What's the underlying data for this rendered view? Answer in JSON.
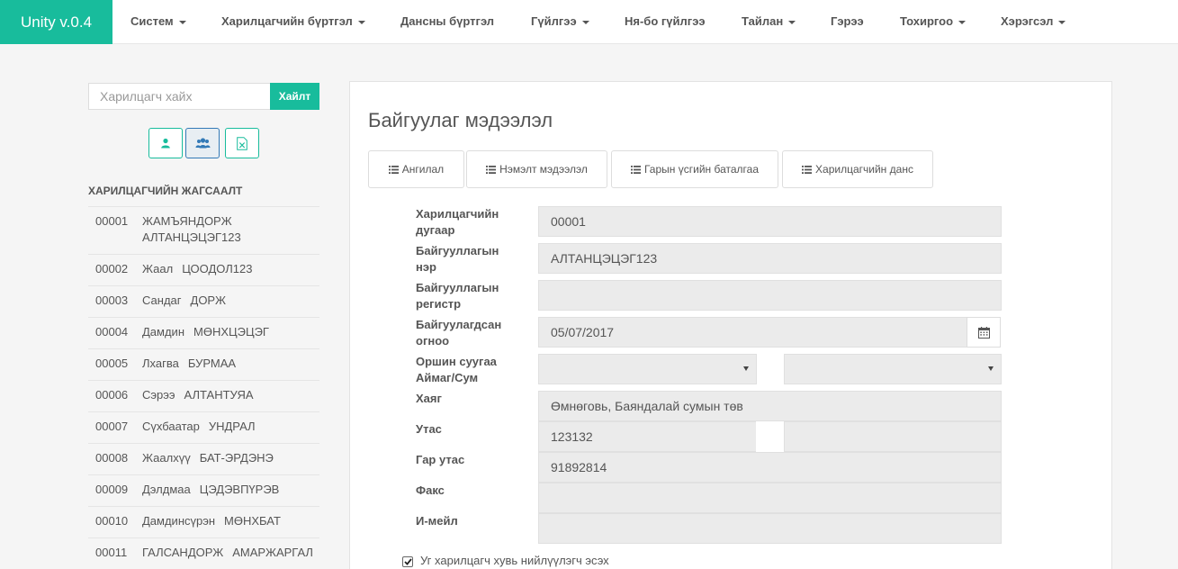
{
  "nav": {
    "brand": "Unity v.0.4",
    "items": [
      {
        "label": "Систем",
        "dropdown": true
      },
      {
        "label": "Харилцагчийн бүртгэл",
        "dropdown": true
      },
      {
        "label": "Дансны бүртгэл",
        "dropdown": false
      },
      {
        "label": "Гүйлгээ",
        "dropdown": true
      },
      {
        "label": "Ня-бо гүйлгээ",
        "dropdown": false
      },
      {
        "label": "Тайлан",
        "dropdown": true
      },
      {
        "label": "Гэрээ",
        "dropdown": false
      },
      {
        "label": "Тохиргоо",
        "dropdown": true
      },
      {
        "label": "Хэрэгсэл",
        "dropdown": true
      }
    ]
  },
  "sidebar": {
    "search_placeholder": "Харилцагч хайх",
    "search_button": "Хайлт",
    "tools": [
      "person-icon",
      "group-icon",
      "excel-icon"
    ],
    "list_title": "ХАРИЛЦАГЧИЙН ЖАГСААЛТ",
    "customers": [
      {
        "num": "00001",
        "first": "ЖАМЪЯНДОРЖ",
        "last": "АЛТАНЦЭЦЭГ123"
      },
      {
        "num": "00002",
        "first": "Жаал",
        "last": "ЦООДОЛ123"
      },
      {
        "num": "00003",
        "first": "Сандаг",
        "last": "ДОРЖ"
      },
      {
        "num": "00004",
        "first": "Дамдин",
        "last": "МӨНХЦЭЦЭГ"
      },
      {
        "num": "00005",
        "first": "Лхагва",
        "last": "БУРМАА"
      },
      {
        "num": "00006",
        "first": "Сэрээ",
        "last": "АЛТАНТУЯА"
      },
      {
        "num": "00007",
        "first": "Сүхбаатар",
        "last": "УНДРАЛ"
      },
      {
        "num": "00008",
        "first": "Жаалхүү",
        "last": "БАТ-ЭРДЭНЭ"
      },
      {
        "num": "00009",
        "first": "Дэлдмаа",
        "last": "ЦЭДЭВПҮРЭВ"
      },
      {
        "num": "00010",
        "first": "Дамдинсүрэн",
        "last": "МӨНХБАТ"
      },
      {
        "num": "00011",
        "first": "ГАЛСАНДОРЖ",
        "last": "АМАРЖАРГАЛ"
      }
    ]
  },
  "main": {
    "title": "Байгуулаг мэдээлэл",
    "tabs": [
      "Ангилал",
      "Нэмэлт мэдээлэл",
      "Гарын үсгийн баталгаа",
      "Харилцагчийн данс"
    ],
    "fields": {
      "customer_number_label": "Харилцагчийн дугаар",
      "customer_number": "00001",
      "org_name_label": "Байгууллагын нэр",
      "org_name": "АЛТАНЦЭЦЭГ123",
      "org_register_label": "Байгууллагын регистр",
      "org_register": "",
      "founded_label": "Байгуулагдсан огноо",
      "founded": "05/07/2017",
      "residence_label": "Оршин суугаа Аймаг/Сум",
      "aimag": "",
      "sum": "",
      "address_label": "Хаяг",
      "address": "Өмнөговь, Баяндалай сумын төв",
      "phone_label": "Утас",
      "phone": "123132",
      "phone2": "",
      "mobile_label": "Гар утас",
      "mobile": "91892814",
      "fax_label": "Факс",
      "fax": "",
      "email_label": "И-мейл",
      "email": ""
    },
    "individual_checkbox": {
      "label": "Уг харилцагч хувь нийлүүлэгч эсэх",
      "checked": true
    }
  }
}
